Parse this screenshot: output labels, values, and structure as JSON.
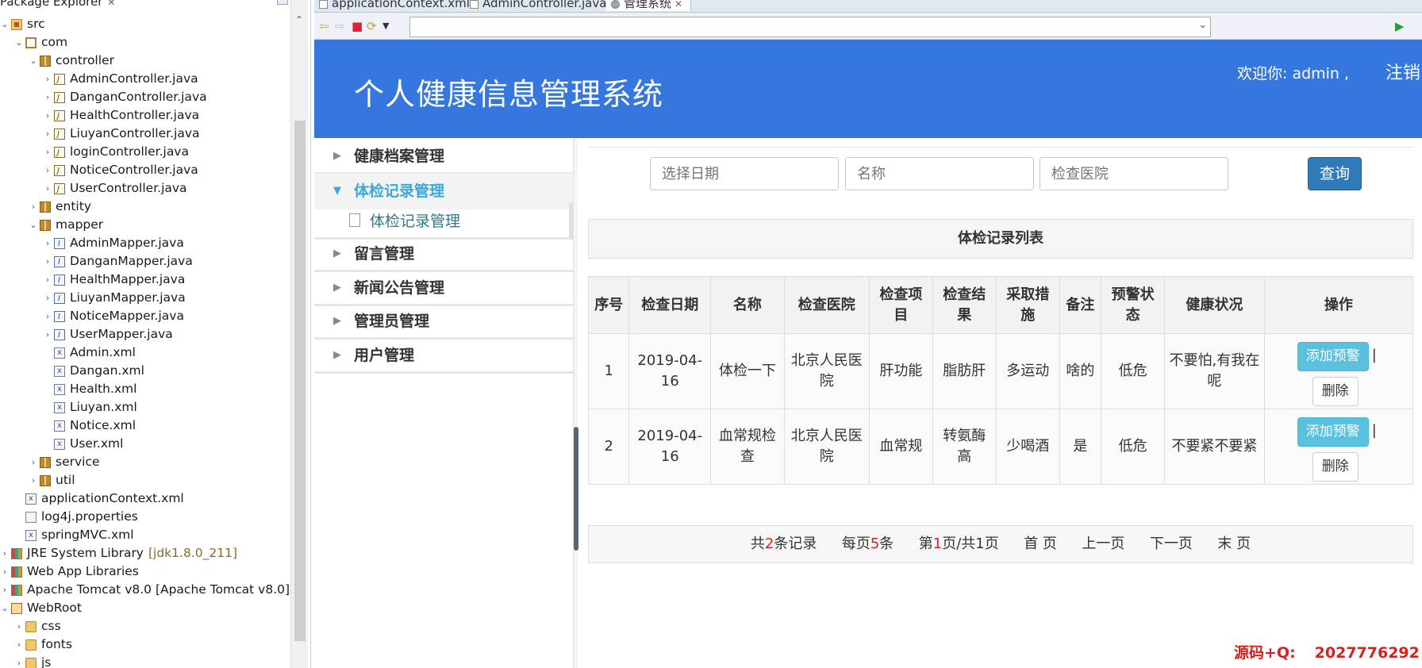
{
  "explorer": {
    "title": "Package Explorer",
    "tree": [
      {
        "label": "src",
        "indent": 0,
        "twisty": "v",
        "icon": "src"
      },
      {
        "label": "com",
        "indent": 1,
        "twisty": "v",
        "icon": "pkgo"
      },
      {
        "label": "controller",
        "indent": 2,
        "twisty": "v",
        "icon": "pkg"
      },
      {
        "label": "AdminController.java",
        "indent": 3,
        "twisty": ">",
        "icon": "java"
      },
      {
        "label": "DanganController.java",
        "indent": 3,
        "twisty": ">",
        "icon": "java"
      },
      {
        "label": "HealthController.java",
        "indent": 3,
        "twisty": ">",
        "icon": "java"
      },
      {
        "label": "LiuyanController.java",
        "indent": 3,
        "twisty": ">",
        "icon": "java"
      },
      {
        "label": "loginController.java",
        "indent": 3,
        "twisty": ">",
        "icon": "java"
      },
      {
        "label": "NoticeController.java",
        "indent": 3,
        "twisty": ">",
        "icon": "java"
      },
      {
        "label": "UserController.java",
        "indent": 3,
        "twisty": ">",
        "icon": "java"
      },
      {
        "label": "entity",
        "indent": 2,
        "twisty": ">",
        "icon": "pkg"
      },
      {
        "label": "mapper",
        "indent": 2,
        "twisty": "v",
        "icon": "pkg"
      },
      {
        "label": "AdminMapper.java",
        "indent": 3,
        "twisty": ">",
        "icon": "ijava"
      },
      {
        "label": "DanganMapper.java",
        "indent": 3,
        "twisty": ">",
        "icon": "ijava"
      },
      {
        "label": "HealthMapper.java",
        "indent": 3,
        "twisty": ">",
        "icon": "ijava"
      },
      {
        "label": "LiuyanMapper.java",
        "indent": 3,
        "twisty": ">",
        "icon": "ijava"
      },
      {
        "label": "NoticeMapper.java",
        "indent": 3,
        "twisty": ">",
        "icon": "ijava"
      },
      {
        "label": "UserMapper.java",
        "indent": 3,
        "twisty": ">",
        "icon": "ijava"
      },
      {
        "label": "Admin.xml",
        "indent": 3,
        "twisty": "",
        "icon": "xml"
      },
      {
        "label": "Dangan.xml",
        "indent": 3,
        "twisty": "",
        "icon": "xml"
      },
      {
        "label": "Health.xml",
        "indent": 3,
        "twisty": "",
        "icon": "xml"
      },
      {
        "label": "Liuyan.xml",
        "indent": 3,
        "twisty": "",
        "icon": "xml"
      },
      {
        "label": "Notice.xml",
        "indent": 3,
        "twisty": "",
        "icon": "xml"
      },
      {
        "label": "User.xml",
        "indent": 3,
        "twisty": "",
        "icon": "xml"
      },
      {
        "label": "service",
        "indent": 2,
        "twisty": ">",
        "icon": "pkg"
      },
      {
        "label": "util",
        "indent": 2,
        "twisty": ">",
        "icon": "pkg"
      },
      {
        "label": "applicationContext.xml",
        "indent": 1,
        "twisty": "",
        "icon": "xml"
      },
      {
        "label": "log4j.properties",
        "indent": 1,
        "twisty": "",
        "icon": "prop"
      },
      {
        "label": "springMVC.xml",
        "indent": 1,
        "twisty": "",
        "icon": "xml"
      },
      {
        "label": "JRE System Library",
        "decoration": "[jdk1.8.0_211]",
        "indent": 0,
        "twisty": ">",
        "icon": "lib"
      },
      {
        "label": "Web App Libraries",
        "indent": 0,
        "twisty": ">",
        "icon": "lib"
      },
      {
        "label": "Apache Tomcat v8.0 [Apache Tomcat v8.0]",
        "indent": 0,
        "twisty": ">",
        "icon": "lib"
      },
      {
        "label": "WebRoot",
        "indent": 0,
        "twisty": "v",
        "icon": "webroot"
      },
      {
        "label": "css",
        "indent": 1,
        "twisty": ">",
        "icon": "folder"
      },
      {
        "label": "fonts",
        "indent": 1,
        "twisty": ">",
        "icon": "folder"
      },
      {
        "label": "js",
        "indent": 1,
        "twisty": ">",
        "icon": "folder"
      }
    ]
  },
  "editor_tabs": [
    {
      "label": "applicationContext.xml",
      "active": false
    },
    {
      "label": "AdminController.java",
      "active": false
    },
    {
      "label": "管理系统",
      "active": true
    }
  ],
  "browser": {
    "url": ""
  },
  "app": {
    "title": "个人健康信息管理系统",
    "welcome": "欢迎你: admin ,",
    "logout": "注销",
    "accent": "#3577de"
  },
  "menu": {
    "items": [
      {
        "label": "健康档案管理"
      },
      {
        "label": "体检记录管理",
        "open": true,
        "sub": "体检记录管理"
      },
      {
        "label": "留言管理"
      },
      {
        "label": "新闻公告管理"
      },
      {
        "label": "管理员管理"
      },
      {
        "label": "用户管理"
      }
    ]
  },
  "filters": {
    "date_placeholder": "选择日期",
    "name_placeholder": "名称",
    "hospital_placeholder": "检查医院",
    "query_label": "查询"
  },
  "records": {
    "caption": "体检记录列表",
    "columns": [
      "序号",
      "检查日期",
      "名称",
      "检查医院",
      "检查项目",
      "检查结果",
      "采取措施",
      "备注",
      "预警状态",
      "健康状况",
      "操作"
    ],
    "rows": [
      {
        "no": "1",
        "date": "2019-04-16",
        "name": "体检一下",
        "hospital": "北京人民医院",
        "item": "肝功能",
        "result": "脂肪肝",
        "measure": "多运动",
        "remark": "啥的",
        "warn": "低危",
        "status": "不要怕,有我在呢",
        "warn_btn": "添加预警",
        "sep": "|",
        "del_btn": "删除"
      },
      {
        "no": "2",
        "date": "2019-04-16",
        "name": "血常规检查",
        "hospital": "北京人民医院",
        "item": "血常规",
        "result": "转氨酶高",
        "measure": "少喝酒",
        "remark": "是",
        "warn": "低危",
        "status": "不要紧不要紧",
        "warn_btn": "添加预警",
        "sep": "|",
        "del_btn": "删除"
      }
    ]
  },
  "pager": {
    "total_prefix": "共",
    "total": "2",
    "total_suffix": "条记录",
    "per_prefix": "每页",
    "per": "5",
    "per_suffix": "条",
    "page_prefix": "第",
    "page": "1",
    "page_mid": "页/共1页",
    "first": "首 页",
    "prev": "上一页",
    "next": "下一页",
    "last": "末 页"
  },
  "watermark": {
    "label": "源码+Q:",
    "number": "2027776292"
  }
}
